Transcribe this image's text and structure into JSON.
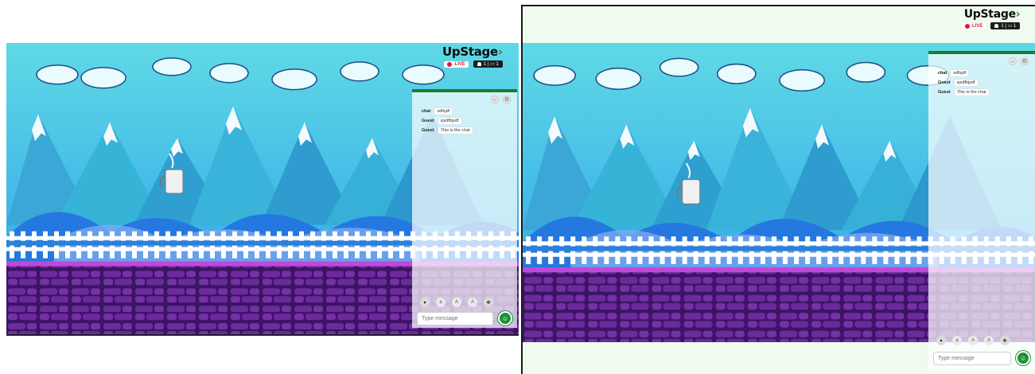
{
  "app": {
    "logo_text": "UpStage",
    "logo_tick": "›"
  },
  "status": {
    "live_label": "LIVE",
    "counter_icons": "1 | ▭ 1"
  },
  "chat": {
    "messages": [
      {
        "sender": "chat",
        "text": "sdfsjdf"
      },
      {
        "sender": "Guest",
        "text": "sjsdfbjsdf"
      },
      {
        "sender": "Guest",
        "text": "This is the chat"
      }
    ],
    "input_placeholder": "Type message",
    "minimize_icon": "minimize-icon",
    "settings_icon": "gear-icon",
    "tools": [
      "chevron-down-icon",
      "font-smaller-icon",
      "font-medium-icon",
      "font-larger-icon",
      "move-icon"
    ],
    "tool_glyphs": [
      "▾",
      "a",
      "A",
      "A",
      "✥"
    ],
    "send_icon": "emoji-icon"
  },
  "colors": {
    "sky_top": "#58d6e4",
    "sky_bottom": "#2aa5e6",
    "chat_border": "#1e7a34",
    "live_red": "#e01b2f",
    "wall_purple": "#6a2a9a"
  }
}
